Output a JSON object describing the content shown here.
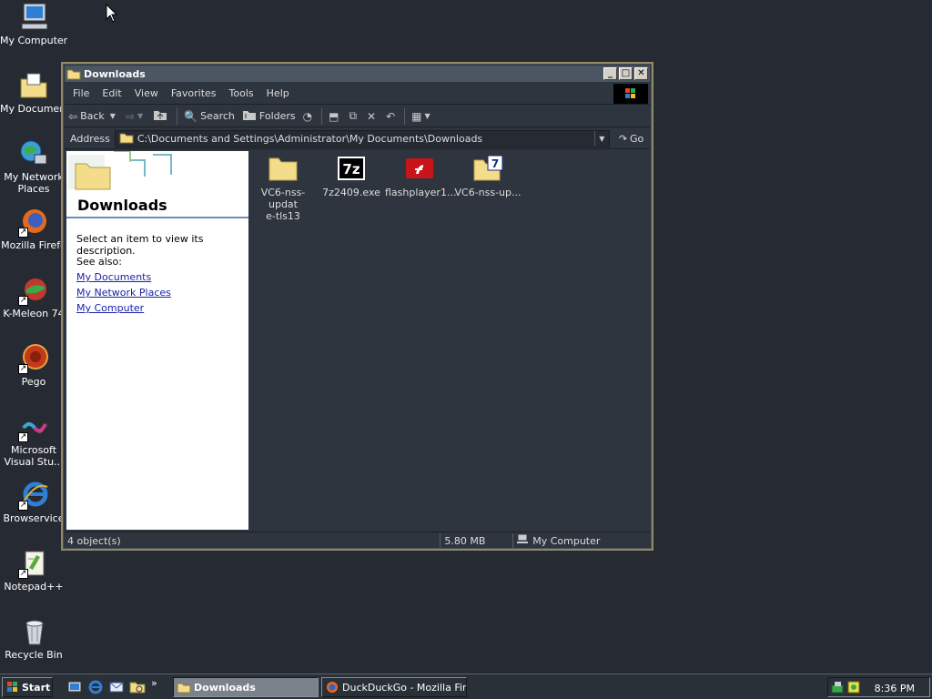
{
  "desktop": {
    "icons": [
      {
        "label": "My Computer",
        "icon": "my-computer-icon"
      },
      {
        "label": "My Document",
        "icon": "my-documents-icon"
      },
      {
        "label": "My Network Places",
        "line1": "My Network",
        "line2": "Places",
        "icon": "network-places-icon"
      },
      {
        "label": "Mozilla Firefo",
        "icon": "firefox-icon"
      },
      {
        "label": "K-Meleon 74",
        "icon": "kmeleon-icon"
      },
      {
        "label": "Pego",
        "icon": "pego-icon"
      },
      {
        "label": "Microsoft Visual Stu...",
        "line1": "Microsoft",
        "line2": "Visual Stu...",
        "icon": "visual-studio-icon"
      },
      {
        "label": "Browservice",
        "icon": "internet-explorer-icon"
      },
      {
        "label": "Notepad++",
        "icon": "notepadpp-icon"
      },
      {
        "label": "Recycle Bin",
        "icon": "recycle-bin-icon"
      }
    ]
  },
  "window": {
    "title": "Downloads",
    "menu": [
      "File",
      "Edit",
      "View",
      "Favorites",
      "Tools",
      "Help"
    ],
    "toolbar": {
      "back": "Back",
      "search": "Search",
      "folders": "Folders"
    },
    "address": {
      "label": "Address",
      "value": "C:\\Documents and Settings\\Administrator\\My Documents\\Downloads",
      "go": "Go"
    },
    "taskpane": {
      "title": "Downloads",
      "description": "Select an item to view its description.",
      "see_also": "See also:",
      "links": [
        "My Documents",
        "My Network Places",
        "My Computer"
      ]
    },
    "files": [
      {
        "name_line1": "VC6-nss-updat",
        "name_line2": "e-tls13",
        "icon": "folder-icon"
      },
      {
        "name_line1": "7z2409.exe",
        "name_line2": "",
        "icon": "sevenzip-icon"
      },
      {
        "name_line1": "flashplayer1...",
        "name_line2": "",
        "icon": "flash-installer-icon"
      },
      {
        "name_line1": "VC6-nss-up...",
        "name_line2": "",
        "icon": "sevenzip-archive-icon"
      }
    ],
    "status": {
      "objects": "4 object(s)",
      "size": "5.80 MB",
      "location": "My Computer"
    }
  },
  "taskbar": {
    "start": "Start",
    "tasks": [
      {
        "label": "Downloads",
        "active": true
      },
      {
        "label": "DuckDuckGo - Mozilla Fire...",
        "active": false
      }
    ],
    "clock": "8:36 PM"
  },
  "colors": {
    "desktop": "#262b33",
    "window_bg": "#2f353e",
    "window_border": "#8f8a66",
    "link": "#1a22a8",
    "folder": "#f3dc8a"
  }
}
